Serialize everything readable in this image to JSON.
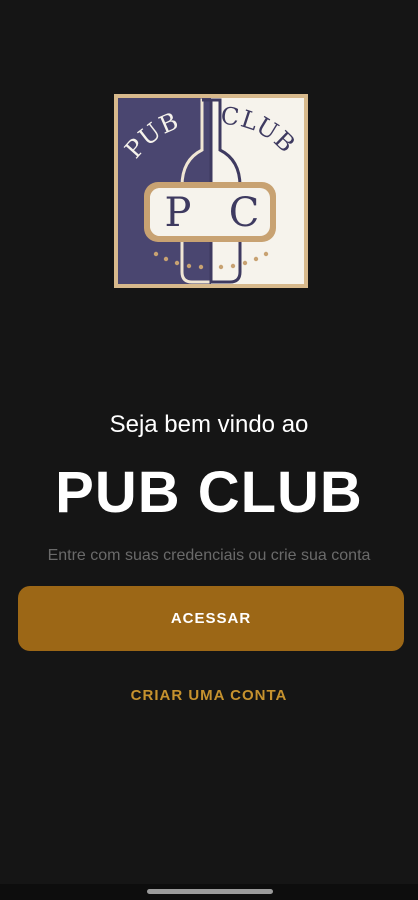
{
  "logo": {
    "top_text": "PUB CLUB",
    "initial_left": "P",
    "initial_right": "C"
  },
  "welcome": {
    "greeting": "Seja bem vindo ao",
    "title": "PUB CLUB",
    "subtitle": "Entre com suas credenciais ou crie sua conta"
  },
  "actions": {
    "primary_label": "ACESSAR",
    "secondary_label": "CRIAR UMA CONTA"
  },
  "colors": {
    "background": "#151515",
    "accent": "#9c6716",
    "link": "#c6922e",
    "logo_purple": "#4a4670"
  }
}
